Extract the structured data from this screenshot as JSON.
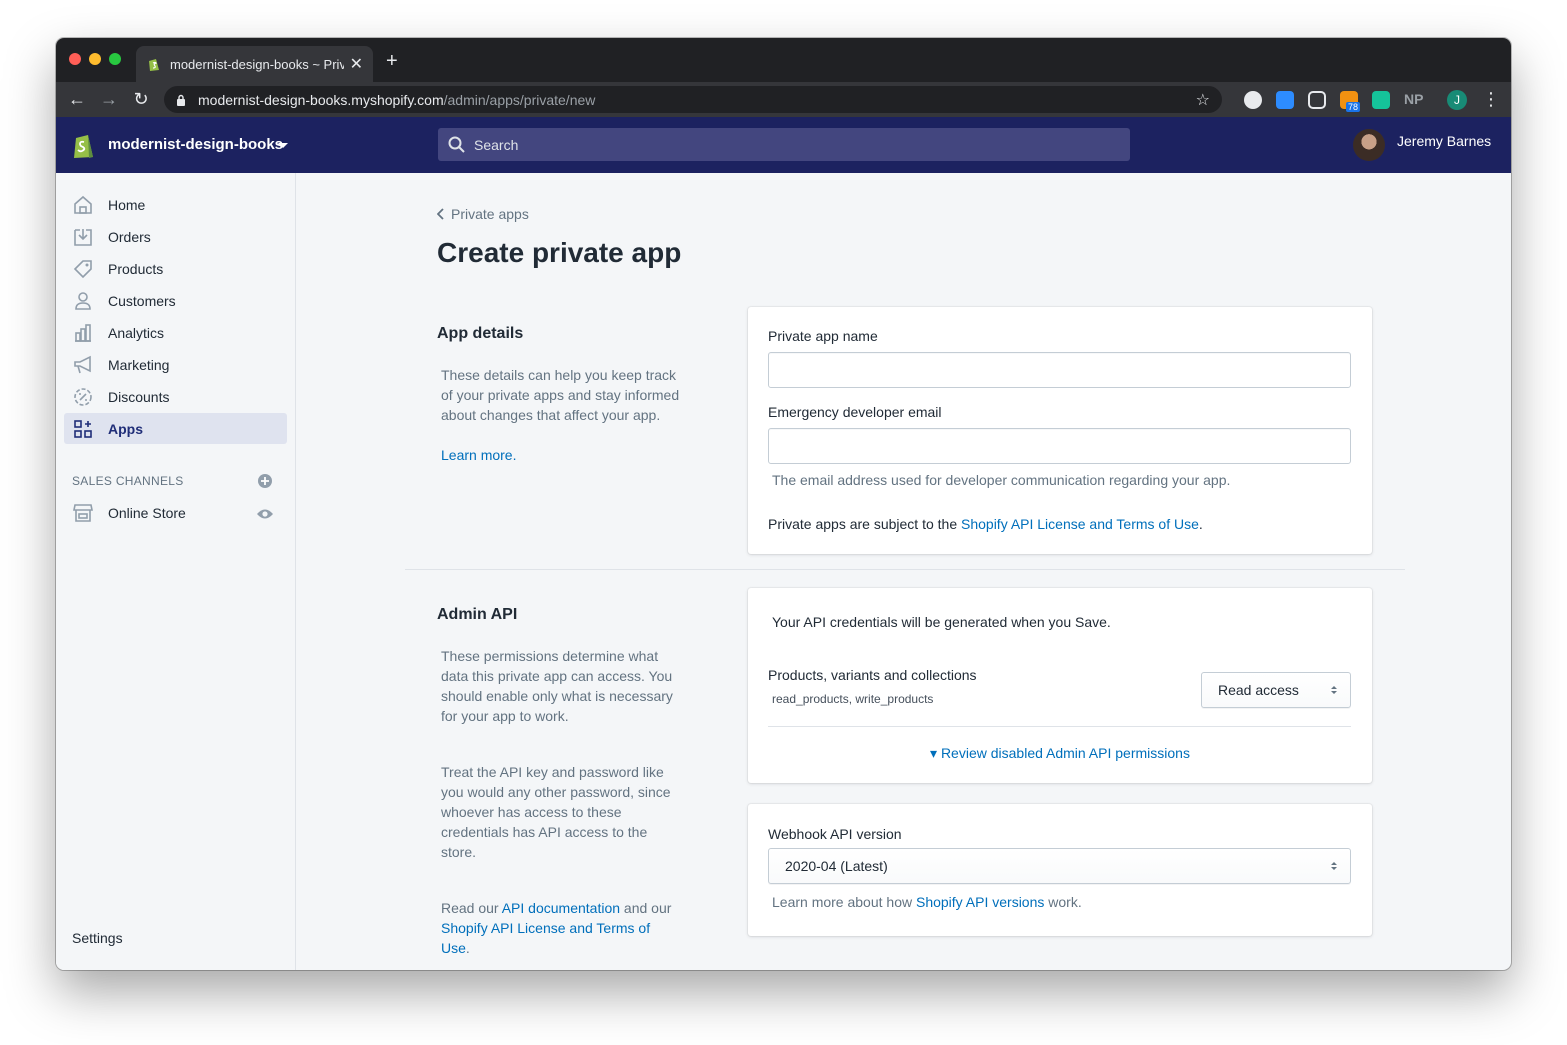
{
  "browser": {
    "tab_title": "modernist-design-books ~ Priva",
    "tab_close": "✕",
    "new_tab": "+",
    "url_host": "modernist-design-books.myshopify.com",
    "url_path": "/admin/apps/private/new",
    "nav_back": "←",
    "nav_forward": "→",
    "nav_reload": "↻",
    "bookmark": "☆",
    "extensions": {
      "rss_badge": "78",
      "np_label": "NP",
      "profile_initial": "J",
      "menu": "⋮"
    }
  },
  "topbar": {
    "store_name": "modernist-design-books",
    "search_placeholder": "Search",
    "user_name": "Jeremy Barnes"
  },
  "sidebar": {
    "items": [
      {
        "label": "Home",
        "icon": "home-icon"
      },
      {
        "label": "Orders",
        "icon": "orders-icon"
      },
      {
        "label": "Products",
        "icon": "tag-icon"
      },
      {
        "label": "Customers",
        "icon": "person-icon"
      },
      {
        "label": "Analytics",
        "icon": "bar-chart-icon"
      },
      {
        "label": "Marketing",
        "icon": "megaphone-icon"
      },
      {
        "label": "Discounts",
        "icon": "discount-icon"
      },
      {
        "label": "Apps",
        "icon": "apps-icon",
        "active": true
      }
    ],
    "sales_channels_label": "SALES CHANNELS",
    "online_store_label": "Online Store",
    "settings_label": "Settings"
  },
  "main": {
    "breadcrumb": "Private apps",
    "title": "Create private app",
    "app_details": {
      "title": "App details",
      "description": "These details can help you keep track of your private apps and stay informed about changes that affect your app.",
      "learn_more": "Learn more.",
      "name_label": "Private app name",
      "name_value": "",
      "email_label": "Emergency developer email",
      "email_value": "",
      "email_help": "The email address used for developer communication regarding your app.",
      "terms_prefix": "Private apps are subject to the ",
      "terms_link": "Shopify API License and Terms of Use",
      "terms_suffix": "."
    },
    "admin_api": {
      "title": "Admin API",
      "description1": "These permissions determine what data this private app can access. You should enable only what is necessary for your app to work.",
      "description2": "Treat the API key and password like you would any other password, since whoever has access to these credentials has API access to the store.",
      "read_our": "Read our ",
      "api_docs_link": "API documentation",
      "and_our": " and our ",
      "terms_link": "Shopify API License and Terms of Use",
      "period": ".",
      "credentials_note": "Your API credentials will be generated when you Save.",
      "permission_label": "Products, variants and collections",
      "permission_scopes": "read_products, write_products",
      "permission_value": "Read access",
      "review_disabled": "▾ Review disabled Admin API permissions"
    },
    "webhook": {
      "label": "Webhook API version",
      "value": "2020-04 (Latest)",
      "help_prefix": "Learn more about how ",
      "help_link": "Shopify API versions",
      "help_suffix": " work."
    }
  },
  "colors": {
    "topbar": "#1c2260",
    "link": "#006fbb",
    "active_nav": "#202e78"
  }
}
